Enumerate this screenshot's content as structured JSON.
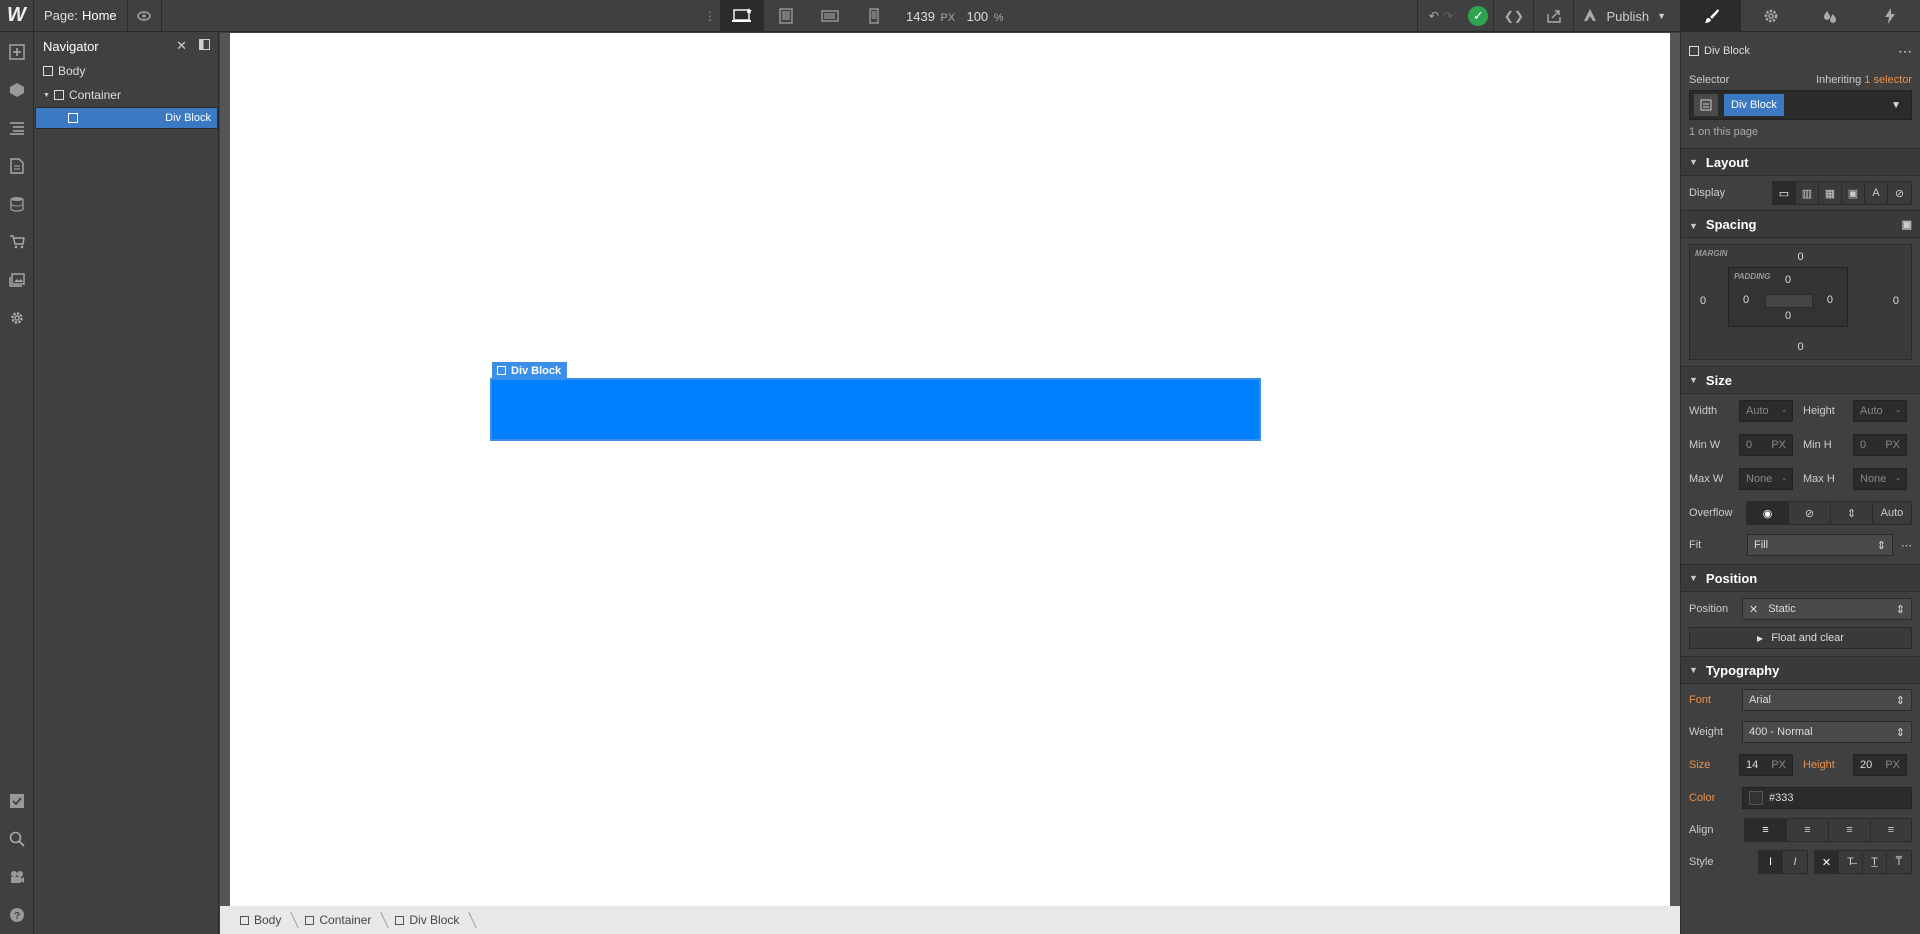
{
  "topbar": {
    "logo": "W",
    "page_prefix": "Page:",
    "page_name": "Home",
    "width_value": "1439",
    "width_unit": "PX",
    "zoom_value": "100",
    "zoom_unit": "%",
    "publish_label": "Publish"
  },
  "navigator": {
    "title": "Navigator",
    "items": [
      {
        "label": "Body"
      },
      {
        "label": "Container"
      },
      {
        "label": "Div Block"
      }
    ]
  },
  "canvas": {
    "selected_label": "Div Block",
    "block_color": "#0080ff"
  },
  "breadcrumb": [
    "Body",
    "Container",
    "Div Block"
  ],
  "panel": {
    "element_name": "Div Block",
    "selector_label": "Selector",
    "inheriting_prefix": "Inheriting",
    "inheriting_link": "1 selector",
    "selector_chip": "Div Block",
    "on_page": "1 on this page",
    "layout": {
      "title": "Layout",
      "display_label": "Display"
    },
    "spacing": {
      "title": "Spacing",
      "margin_label": "MARGIN",
      "padding_label": "PADDING",
      "margin": {
        "top": "0",
        "right": "0",
        "bottom": "0",
        "left": "0"
      },
      "padding": {
        "top": "0",
        "right": "0",
        "bottom": "0",
        "left": "0"
      }
    },
    "size": {
      "title": "Size",
      "width_label": "Width",
      "width_value": "Auto",
      "height_label": "Height",
      "height_value": "Auto",
      "minw_label": "Min W",
      "minw_value": "0",
      "minw_unit": "PX",
      "minh_label": "Min H",
      "minh_value": "0",
      "minh_unit": "PX",
      "maxw_label": "Max W",
      "maxw_value": "None",
      "maxh_label": "Max H",
      "maxh_value": "None",
      "dash": "-",
      "overflow_label": "Overflow",
      "overflow_auto": "Auto",
      "fit_label": "Fit",
      "fit_value": "Fill"
    },
    "position": {
      "title": "Position",
      "position_label": "Position",
      "position_value": "Static",
      "float_label": "Float and clear"
    },
    "typography": {
      "title": "Typography",
      "font_label": "Font",
      "font_value": "Arial",
      "weight_label": "Weight",
      "weight_value": "400 - Normal",
      "size_label": "Size",
      "size_value": "14",
      "size_unit": "PX",
      "height_label": "Height",
      "height_value": "20",
      "height_unit": "PX",
      "color_label": "Color",
      "color_value": "#333",
      "align_label": "Align",
      "style_label": "Style"
    }
  }
}
